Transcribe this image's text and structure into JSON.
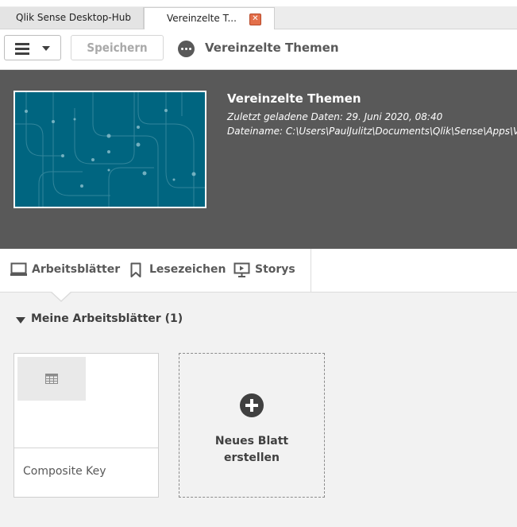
{
  "tabs": [
    {
      "label": "Qlik Sense Desktop-Hub"
    },
    {
      "label": "Vereinzelte T..."
    }
  ],
  "toolbar": {
    "save_label": "Speichern",
    "app_title": "Vereinzelte Themen"
  },
  "header": {
    "title": "Vereinzelte Themen",
    "last_loaded": "Zuletzt geladene Daten: 29. Juni 2020, 08:40",
    "filename": "Dateiname: C:\\Users\\PaulJulitz\\Documents\\Qlik\\Sense\\Apps\\Vereinzelte Themen.qvf"
  },
  "nav": {
    "sheets": "Arbeitsblätter",
    "bookmarks": "Lesezeichen",
    "stories": "Storys"
  },
  "section": {
    "title": "Meine Arbeitsblätter (1)"
  },
  "sheets": [
    {
      "name": "Composite Key"
    }
  ],
  "new_sheet": {
    "line1": "Neues Blatt",
    "line2": "erstellen"
  },
  "colors": {
    "header_bg": "#595959",
    "thumbnail_bg": "#006580",
    "close_button": "#e36f4a"
  }
}
